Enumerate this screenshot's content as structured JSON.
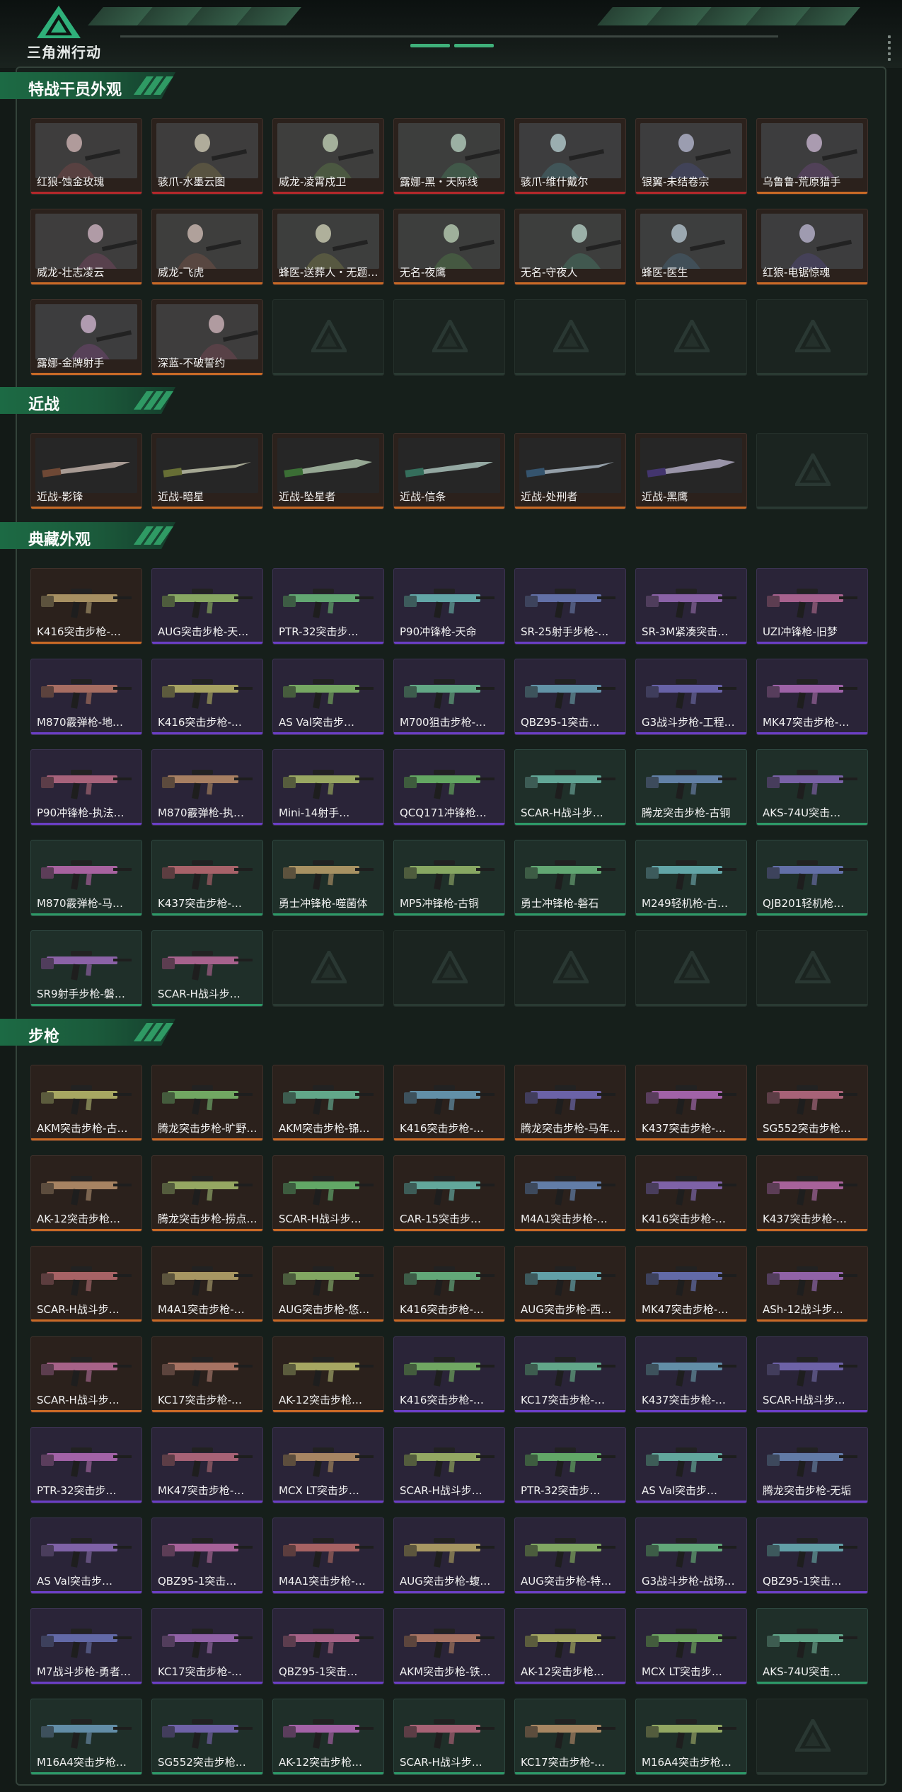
{
  "app": {
    "logo_text": "三角洲行动"
  },
  "colors": {
    "red": "#b5282b",
    "orange": "#c96a26",
    "purple": "#6b3fc6",
    "green": "#2d9a68",
    "empty": "#2a3a33"
  },
  "sections": [
    {
      "id": "operators",
      "title": "特战干员外观",
      "kind": "operator",
      "items": [
        {
          "label": "红狼-蚀金玫瑰",
          "rarity": "red"
        },
        {
          "label": "骇爪-水墨云图",
          "rarity": "red"
        },
        {
          "label": "威龙-凌霄戍卫",
          "rarity": "red"
        },
        {
          "label": "露娜-黑・天际线",
          "rarity": "red"
        },
        {
          "label": "骇爪-维什戴尔",
          "rarity": "red"
        },
        {
          "label": "银翼-未结卷宗",
          "rarity": "red"
        },
        {
          "label": "乌鲁鲁-荒原猎手",
          "rarity": "orange"
        },
        {
          "label": "威龙-壮志凌云",
          "rarity": "orange"
        },
        {
          "label": "威龙-飞虎",
          "rarity": "orange"
        },
        {
          "label": "蜂医-送葬人・无题…",
          "rarity": "orange"
        },
        {
          "label": "无名-夜鹰",
          "rarity": "orange"
        },
        {
          "label": "无名-守夜人",
          "rarity": "orange"
        },
        {
          "label": "蜂医-医生",
          "rarity": "orange"
        },
        {
          "label": "红狼-电锯惊魂",
          "rarity": "orange"
        },
        {
          "label": "露娜-金牌射手",
          "rarity": "orange"
        },
        {
          "label": "深蓝-不破誓约",
          "rarity": "orange"
        }
      ],
      "empty_slots": 5
    },
    {
      "id": "melee",
      "title": "近战",
      "kind": "melee",
      "items": [
        {
          "label": "近战-影锋",
          "rarity": "orange"
        },
        {
          "label": "近战-暗星",
          "rarity": "orange"
        },
        {
          "label": "近战-坠星者",
          "rarity": "orange"
        },
        {
          "label": "近战-信条",
          "rarity": "orange"
        },
        {
          "label": "近战-处刑者",
          "rarity": "orange"
        },
        {
          "label": "近战-黑鹰",
          "rarity": "orange"
        }
      ],
      "empty_slots": 1
    },
    {
      "id": "collection",
      "title": "典藏外观",
      "kind": "gun",
      "items": [
        {
          "label": "K416突击步枪-…",
          "rarity": "orange"
        },
        {
          "label": "AUG突击步枪-天…",
          "rarity": "purple"
        },
        {
          "label": "PTR-32突击步…",
          "rarity": "purple"
        },
        {
          "label": "P90冲锋枪-天命",
          "rarity": "purple"
        },
        {
          "label": "SR-25射手步枪-…",
          "rarity": "purple"
        },
        {
          "label": "SR-3M紧凑突击…",
          "rarity": "purple"
        },
        {
          "label": "UZI冲锋枪-旧梦",
          "rarity": "purple"
        },
        {
          "label": "M870霰弹枪-地…",
          "rarity": "purple"
        },
        {
          "label": "K416突击步枪-…",
          "rarity": "purple"
        },
        {
          "label": "AS Val突击步…",
          "rarity": "purple"
        },
        {
          "label": "M700狙击步枪-…",
          "rarity": "purple"
        },
        {
          "label": "QBZ95-1突击…",
          "rarity": "purple"
        },
        {
          "label": "G3战斗步枪-工程…",
          "rarity": "purple"
        },
        {
          "label": "MK47突击步枪-…",
          "rarity": "purple"
        },
        {
          "label": "P90冲锋枪-执法…",
          "rarity": "purple"
        },
        {
          "label": "M870霰弹枪-执…",
          "rarity": "purple"
        },
        {
          "label": "Mini-14射手…",
          "rarity": "purple"
        },
        {
          "label": "QCQ171冲锋枪…",
          "rarity": "purple"
        },
        {
          "label": "SCAR-H战斗步…",
          "rarity": "green"
        },
        {
          "label": "腾龙突击步枪-古铜",
          "rarity": "green"
        },
        {
          "label": "AKS-74U突击…",
          "rarity": "green"
        },
        {
          "label": "M870霰弹枪-马…",
          "rarity": "green"
        },
        {
          "label": "K437突击步枪-…",
          "rarity": "green"
        },
        {
          "label": "勇士冲锋枪-噬菌体",
          "rarity": "green"
        },
        {
          "label": "MP5冲锋枪-古铜",
          "rarity": "green"
        },
        {
          "label": "勇士冲锋枪-磐石",
          "rarity": "green"
        },
        {
          "label": "M249轻机枪-古…",
          "rarity": "green"
        },
        {
          "label": "QJB201轻机枪…",
          "rarity": "green"
        },
        {
          "label": "SR9射手步枪-磐…",
          "rarity": "green"
        },
        {
          "label": "SCAR-H战斗步…",
          "rarity": "green"
        }
      ],
      "empty_slots": 5
    },
    {
      "id": "rifles",
      "title": "步枪",
      "kind": "gun",
      "items": [
        {
          "label": "AKM突击步枪-古…",
          "rarity": "orange"
        },
        {
          "label": "腾龙突击步枪-旷野…",
          "rarity": "orange"
        },
        {
          "label": "AKM突击步枪-锦…",
          "rarity": "orange"
        },
        {
          "label": "K416突击步枪-…",
          "rarity": "orange"
        },
        {
          "label": "腾龙突击步枪-马年…",
          "rarity": "orange"
        },
        {
          "label": "K437突击步枪-…",
          "rarity": "orange"
        },
        {
          "label": "SG552突击步枪…",
          "rarity": "orange"
        },
        {
          "label": "AK-12突击步枪…",
          "rarity": "orange"
        },
        {
          "label": "腾龙突击步枪-捞点…",
          "rarity": "orange"
        },
        {
          "label": "SCAR-H战斗步…",
          "rarity": "orange"
        },
        {
          "label": "CAR-15突击步…",
          "rarity": "orange"
        },
        {
          "label": "M4A1突击步枪-…",
          "rarity": "orange"
        },
        {
          "label": "K416突击步枪-…",
          "rarity": "orange"
        },
        {
          "label": "K437突击步枪-…",
          "rarity": "orange"
        },
        {
          "label": "SCAR-H战斗步…",
          "rarity": "orange"
        },
        {
          "label": "M4A1突击步枪-…",
          "rarity": "orange"
        },
        {
          "label": "AUG突击步枪-悠…",
          "rarity": "orange"
        },
        {
          "label": "K416突击步枪-…",
          "rarity": "orange"
        },
        {
          "label": "AUG突击步枪-西…",
          "rarity": "orange"
        },
        {
          "label": "MK47突击步枪-…",
          "rarity": "orange"
        },
        {
          "label": "ASh-12战斗步…",
          "rarity": "orange"
        },
        {
          "label": "SCAR-H战斗步…",
          "rarity": "orange"
        },
        {
          "label": "KC17突击步枪-…",
          "rarity": "orange"
        },
        {
          "label": "AK-12突击步枪…",
          "rarity": "orange"
        },
        {
          "label": "K416突击步枪-…",
          "rarity": "purple"
        },
        {
          "label": "KC17突击步枪-…",
          "rarity": "purple"
        },
        {
          "label": "K437突击步枪-…",
          "rarity": "purple"
        },
        {
          "label": "SCAR-H战斗步…",
          "rarity": "purple"
        },
        {
          "label": "PTR-32突击步…",
          "rarity": "purple"
        },
        {
          "label": "MK47突击步枪-…",
          "rarity": "purple"
        },
        {
          "label": "MCX LT突击步…",
          "rarity": "purple"
        },
        {
          "label": "SCAR-H战斗步…",
          "rarity": "purple"
        },
        {
          "label": "PTR-32突击步…",
          "rarity": "purple"
        },
        {
          "label": "AS Val突击步…",
          "rarity": "purple"
        },
        {
          "label": "腾龙突击步枪-无垢",
          "rarity": "purple"
        },
        {
          "label": "AS Val突击步…",
          "rarity": "purple"
        },
        {
          "label": "QBZ95-1突击…",
          "rarity": "purple"
        },
        {
          "label": "M4A1突击步枪-…",
          "rarity": "purple"
        },
        {
          "label": "AUG突击步枪-蝮…",
          "rarity": "purple"
        },
        {
          "label": "AUG突击步枪-特…",
          "rarity": "purple"
        },
        {
          "label": "G3战斗步枪-战场…",
          "rarity": "purple"
        },
        {
          "label": "QBZ95-1突击…",
          "rarity": "purple"
        },
        {
          "label": "M7战斗步枪-勇者…",
          "rarity": "purple"
        },
        {
          "label": "KC17突击步枪-…",
          "rarity": "purple"
        },
        {
          "label": "QBZ95-1突击…",
          "rarity": "purple"
        },
        {
          "label": "AKM突击步枪-铁…",
          "rarity": "purple"
        },
        {
          "label": "AK-12突击步枪…",
          "rarity": "purple"
        },
        {
          "label": "MCX LT突击步…",
          "rarity": "purple"
        },
        {
          "label": "AKS-74U突击…",
          "rarity": "green"
        },
        {
          "label": "M16A4突击步枪…",
          "rarity": "green"
        },
        {
          "label": "SG552突击步枪…",
          "rarity": "green"
        },
        {
          "label": "AK-12突击步枪…",
          "rarity": "green"
        },
        {
          "label": "SCAR-H战斗步…",
          "rarity": "green"
        },
        {
          "label": "KC17突击步枪-…",
          "rarity": "green"
        },
        {
          "label": "M16A4突击步枪…",
          "rarity": "green"
        }
      ],
      "empty_slots": 1
    }
  ]
}
